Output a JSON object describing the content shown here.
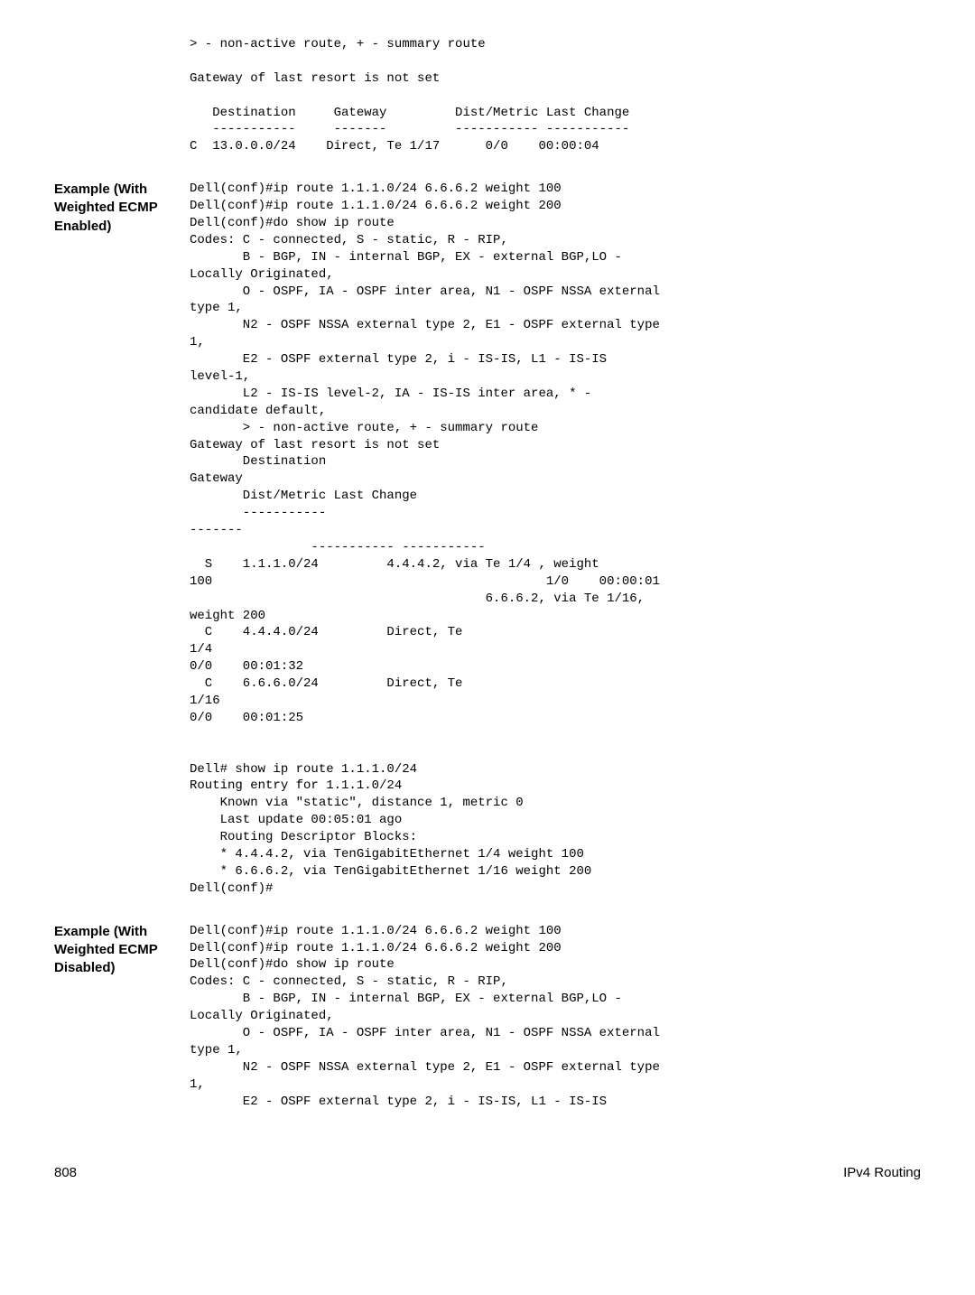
{
  "top_block": "> - non-active route, + - summary route\n\nGateway of last resort is not set\n\n   Destination     Gateway         Dist/Metric Last Change\n   -----------     -------         ----------- -----------\nC  13.0.0.0/24    Direct, Te 1/17      0/0    00:00:04",
  "example1": {
    "label": "Example (With Weighted ECMP Enabled)",
    "code": "Dell(conf)#ip route 1.1.1.0/24 6.6.6.2 weight 100\nDell(conf)#ip route 1.1.1.0/24 6.6.6.2 weight 200\nDell(conf)#do show ip route\nCodes: C - connected, S - static, R - RIP,\n       B - BGP, IN - internal BGP, EX - external BGP,LO - \nLocally Originated,\n       O - OSPF, IA - OSPF inter area, N1 - OSPF NSSA external \ntype 1,\n       N2 - OSPF NSSA external type 2, E1 - OSPF external type \n1,\n       E2 - OSPF external type 2, i - IS-IS, L1 - IS-IS \nlevel-1,\n       L2 - IS-IS level-2, IA - IS-IS inter area, * - \ncandidate default,\n       > - non-active route, + - summary route\nGateway of last resort is not set\n       Destination                               \nGateway                  \n       Dist/Metric Last Change\n       -----------                               \n-------                  \n                ----------- -----------\n  S    1.1.1.0/24         4.4.4.2, via Te 1/4 , weight \n100                                            1/0    00:00:01\n                                       6.6.6.2, via Te 1/16, \nweight 200\n  C    4.4.4.0/24         Direct, Te \n1/4                                             \n0/0    00:01:32\n  C    6.6.6.0/24         Direct, Te \n1/16                                            \n0/0    00:01:25\n\n\nDell# show ip route 1.1.1.0/24\nRouting entry for 1.1.1.0/24\n    Known via \"static\", distance 1, metric 0\n    Last update 00:05:01 ago\n    Routing Descriptor Blocks:\n    * 4.4.4.2, via TenGigabitEthernet 1/4 weight 100\n    * 6.6.6.2, via TenGigabitEthernet 1/16 weight 200\nDell(conf)#"
  },
  "example2": {
    "label": "Example (With Weighted ECMP Disabled)",
    "code": "Dell(conf)#ip route 1.1.1.0/24 6.6.6.2 weight 100\nDell(conf)#ip route 1.1.1.0/24 6.6.6.2 weight 200\nDell(conf)#do show ip route\nCodes: C - connected, S - static, R - RIP,\n       B - BGP, IN - internal BGP, EX - external BGP,LO - \nLocally Originated,\n       O - OSPF, IA - OSPF inter area, N1 - OSPF NSSA external \ntype 1,\n       N2 - OSPF NSSA external type 2, E1 - OSPF external type \n1,\n       E2 - OSPF external type 2, i - IS-IS, L1 - IS-IS "
  },
  "footer": {
    "page": "808",
    "section": "IPv4 Routing"
  }
}
